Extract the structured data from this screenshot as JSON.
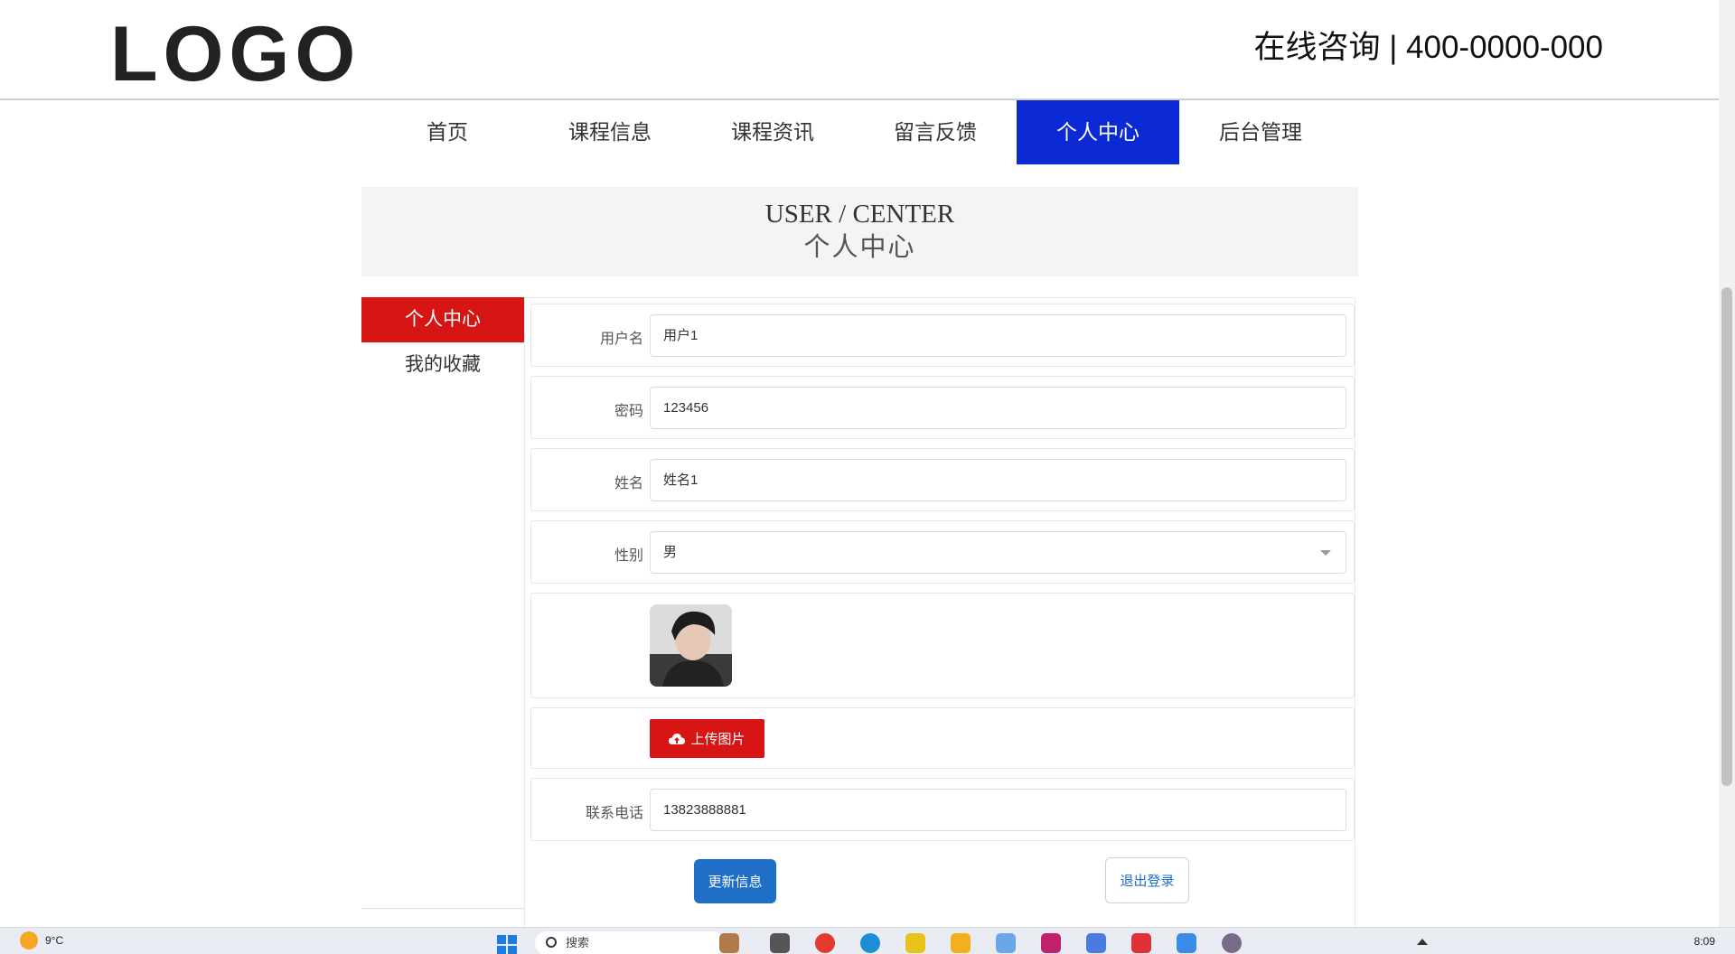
{
  "header": {
    "logo_text": "LOGO",
    "hotline": "在线咨询 | 400-0000-000"
  },
  "nav": {
    "items": [
      {
        "label": "首页",
        "active": false
      },
      {
        "label": "课程信息",
        "active": false
      },
      {
        "label": "课程资讯",
        "active": false
      },
      {
        "label": "留言反馈",
        "active": false
      },
      {
        "label": "个人中心",
        "active": true
      },
      {
        "label": "后台管理",
        "active": false
      }
    ]
  },
  "banner": {
    "title_en": "USER / CENTER",
    "title_cn": "个人中心"
  },
  "sidebar": {
    "items": [
      {
        "label": "个人中心",
        "active": true
      },
      {
        "label": "我的收藏",
        "active": false
      }
    ]
  },
  "form": {
    "username": {
      "label": "用户名",
      "value": "用户1"
    },
    "password": {
      "label": "密码",
      "value": "123456"
    },
    "name": {
      "label": "姓名",
      "value": "姓名1"
    },
    "gender": {
      "label": "性别",
      "value": "男"
    },
    "upload_label": "上传图片",
    "phone": {
      "label": "联系电话",
      "value": "13823888881"
    },
    "update_label": "更新信息",
    "logout_label": "退出登录"
  },
  "taskbar": {
    "temperature": "9°C",
    "search_label": "搜索",
    "time": "8:09"
  },
  "colors": {
    "nav_active": "#0b2ad6",
    "sidebar_active": "#d81515",
    "upload_button": "#d81515",
    "update_button": "#1f6fc7"
  }
}
